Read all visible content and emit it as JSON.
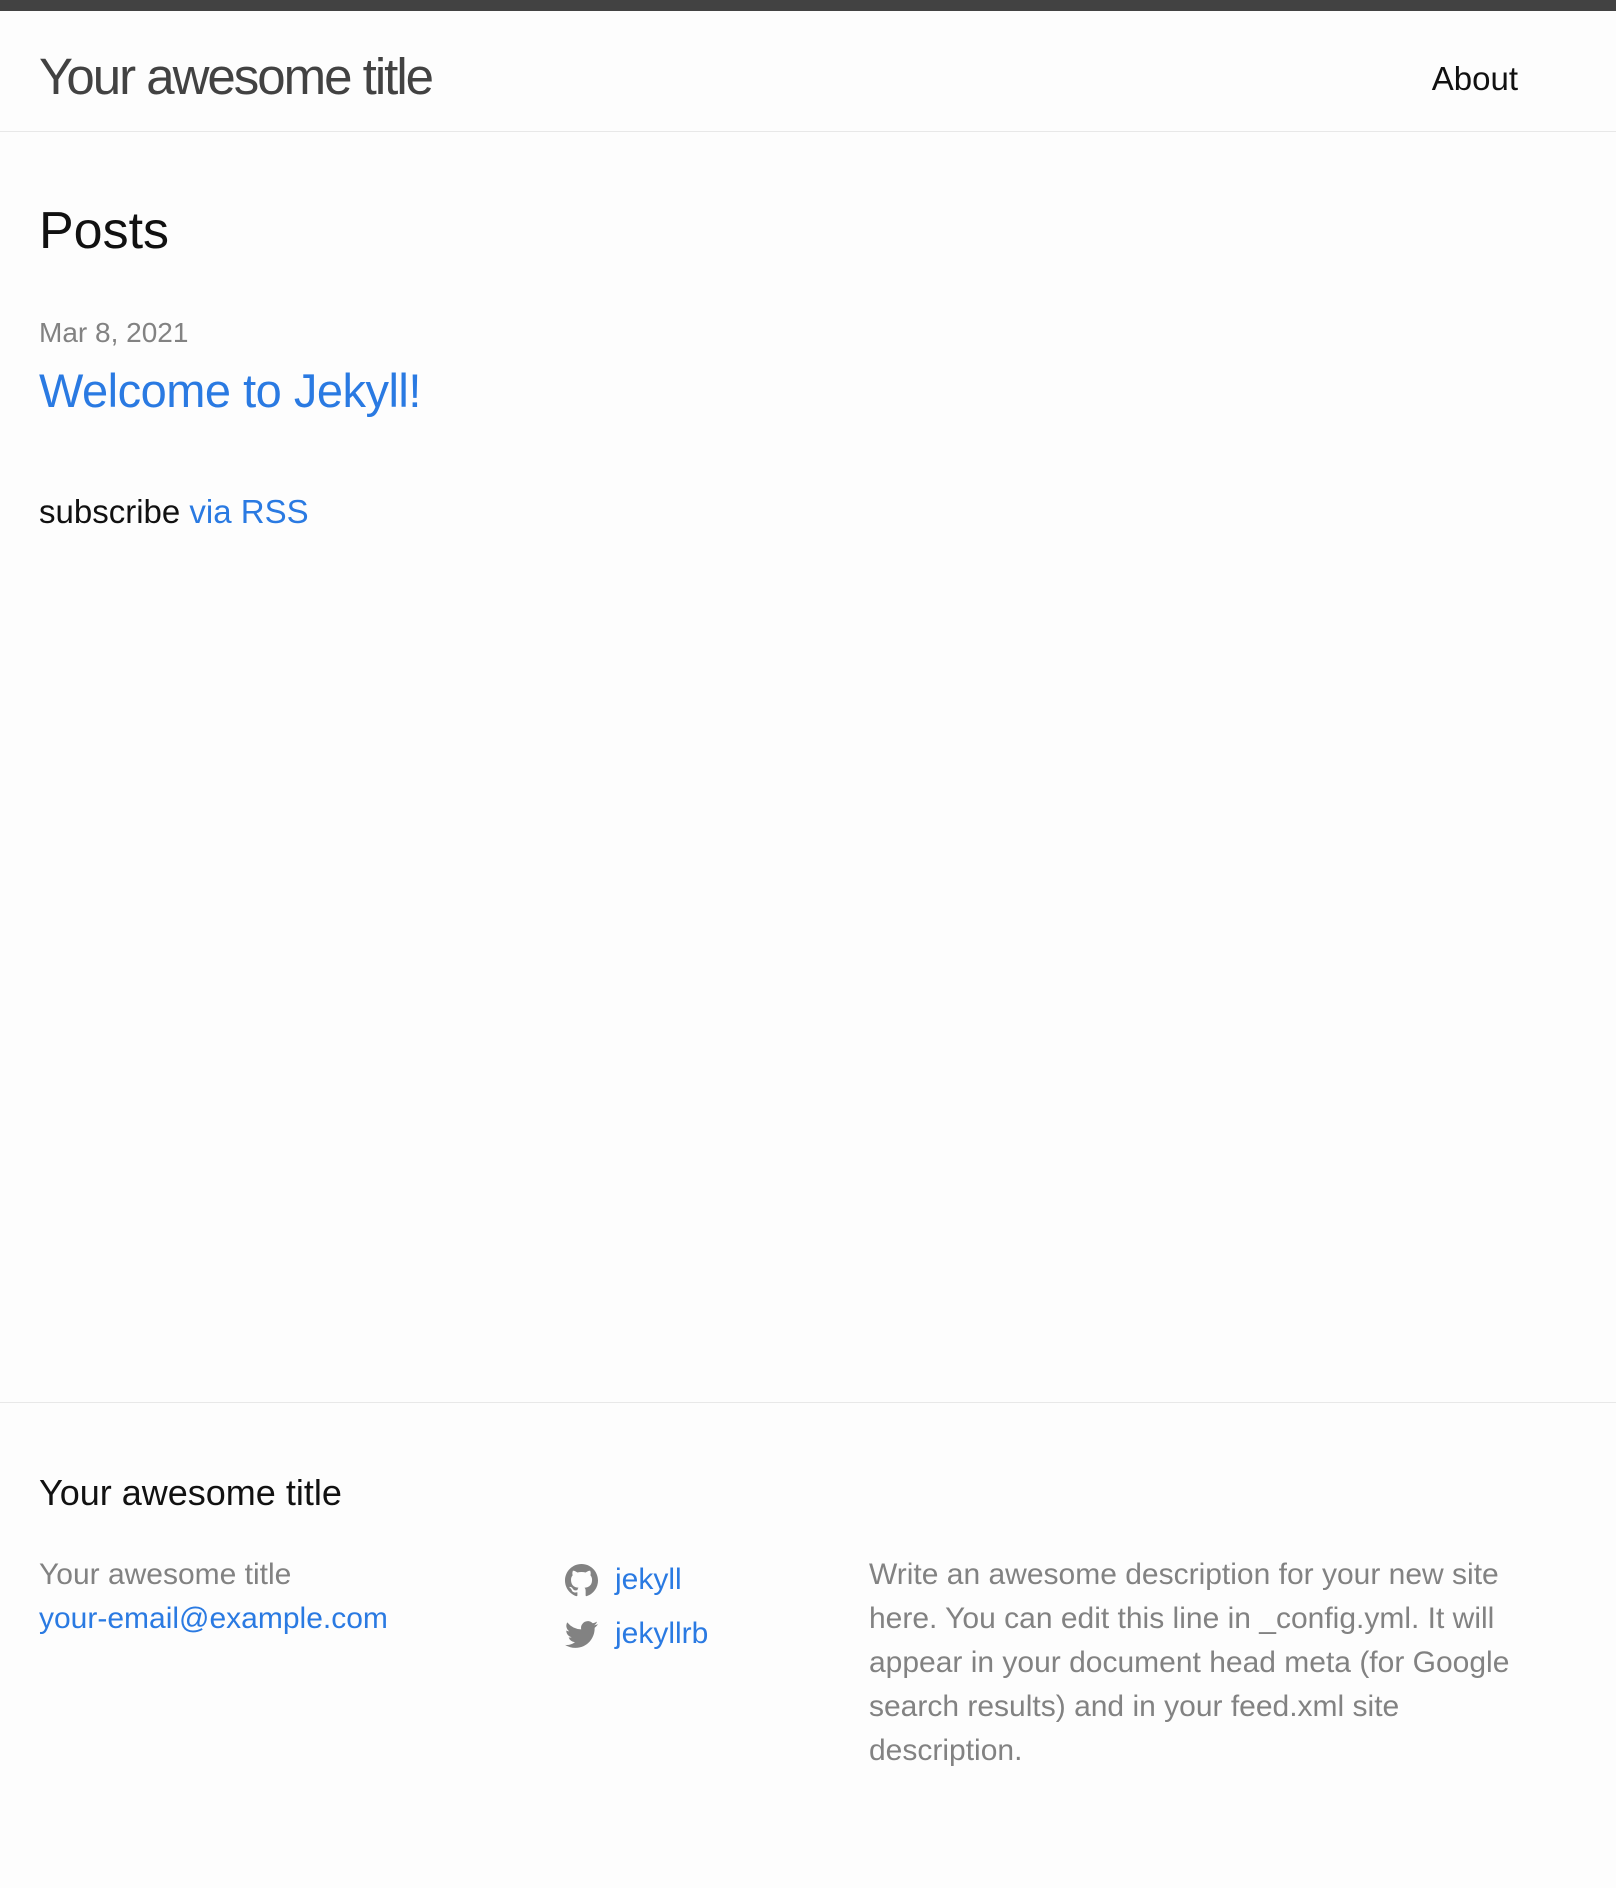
{
  "header": {
    "site_title": "Your awesome title",
    "nav": {
      "about_label": "About"
    }
  },
  "main": {
    "heading": "Posts",
    "posts": [
      {
        "date": "Mar 8, 2021",
        "title": "Welcome to Jekyll!"
      }
    ],
    "subscribe": {
      "prefix": "subscribe",
      "link_label": "via RSS"
    }
  },
  "footer": {
    "heading": "Your awesome title",
    "contact": {
      "name": "Your awesome title",
      "email": "your-email@example.com"
    },
    "social": [
      {
        "icon": "github-icon",
        "label": "jekyll"
      },
      {
        "icon": "twitter-icon",
        "label": "jekyllrb"
      }
    ],
    "description": "Write an awesome description for your new site here. You can edit this line in _config.yml. It will appear in your document head meta (for Google search results) and in your feed.xml site description."
  },
  "colors": {
    "header_bar": "#424242",
    "link": "#2a7ae2",
    "muted_text": "#828282",
    "body_text": "#111111",
    "background": "#fdfdfd",
    "divider": "#e8e8e8"
  }
}
